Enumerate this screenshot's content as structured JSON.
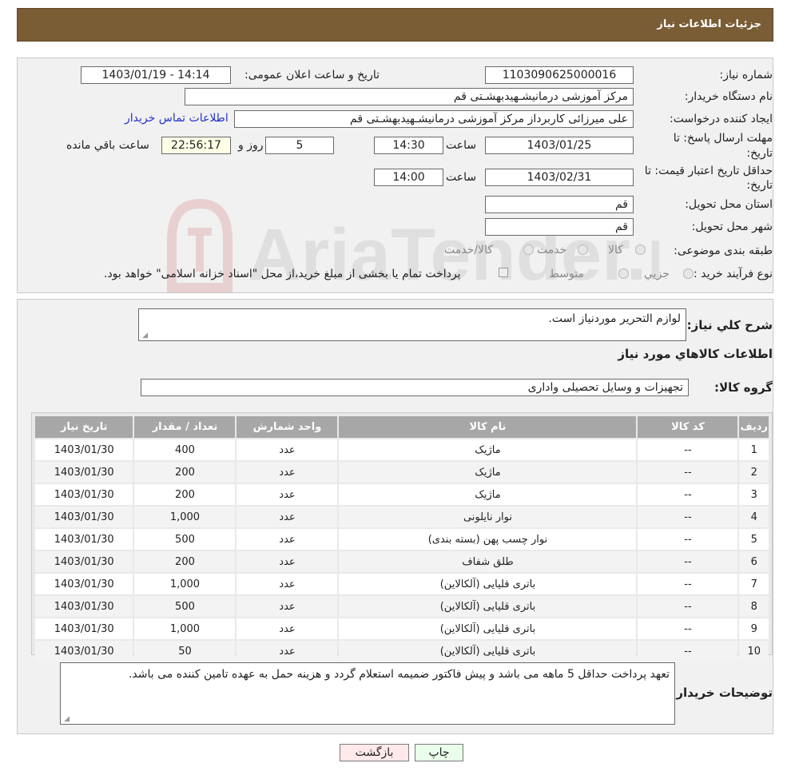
{
  "header": {
    "title": "جزئیات اطلاعات نیاز"
  },
  "form": {
    "need_number_label": "شماره نیاز:",
    "need_number": "1103090625000016",
    "announce_label": "تاریخ و ساعت اعلان عمومی:",
    "announce_value": "1403/01/19 - 14:14",
    "buyer_org_label": "نام دستگاه خریدار:",
    "buyer_org": "مرکز آموزشی درمانیشـهیدبهشـتی قم",
    "creator_label": "ایجاد کننده درخواست:",
    "creator": "علی میرزائی کاربرداز مرکز آموزشی درمانیشـهیدبهشـتی قم",
    "contact_link": "اطلاعات تماس خریدار",
    "deadline_label_1": "مهلت ارسال پاسخ: تا",
    "deadline_label_2": "تاریخ:",
    "deadline_date": "1403/01/25",
    "time_label": "ساعت",
    "deadline_time": "14:30",
    "days_value": "5",
    "days_label": "روز و",
    "remaining_time": "22:56:17",
    "remaining_label": "ساعت باقي مانده",
    "validity_label_1": "حداقل تاریخ اعتبار قیمت: تا",
    "validity_label_2": "تاریخ:",
    "validity_date": "1403/02/31",
    "validity_time": "14:00",
    "province_label": "استان محل تحویل:",
    "province": "قم",
    "city_label": "شهر محل تحویل:",
    "city": "قم",
    "category_label": "طبقه بندی موضوعی:",
    "category_options": [
      "کالا",
      "خدمت",
      "کالا/خدمت"
    ],
    "process_label": "نوع فرآیند خرید :",
    "process_options": [
      "جزیي",
      "متوسط"
    ],
    "payment_note": "پرداخت تمام یا بخشی از مبلغ خرید،از محل \"اسناد خزانه اسلامی\" خواهد بود."
  },
  "summary": {
    "label": "شرح كلي نياز:",
    "text": "لوازم التحریر موردنیاز است."
  },
  "goods": {
    "section_title": "اطلاعات كالاهاي مورد نياز",
    "group_label": "گروه كالا:",
    "group_value": "تجهیزات و وسایل تحصیلی واداری"
  },
  "table": {
    "headers": [
      "ردیف",
      "کد کالا",
      "نام کالا",
      "واحد شمارش",
      "تعداد / مقدار",
      "تاریخ نیاز"
    ],
    "rows": [
      [
        "1",
        "--",
        "ماژیک",
        "عدد",
        "400",
        "1403/01/30"
      ],
      [
        "2",
        "--",
        "ماژیک",
        "عدد",
        "200",
        "1403/01/30"
      ],
      [
        "3",
        "--",
        "ماژیک",
        "عدد",
        "200",
        "1403/01/30"
      ],
      [
        "4",
        "--",
        "نوار نایلونی",
        "عدد",
        "1,000",
        "1403/01/30"
      ],
      [
        "5",
        "--",
        "نوار چسب پهن (بسته بندی)",
        "عدد",
        "500",
        "1403/01/30"
      ],
      [
        "6",
        "--",
        "طلق شفاف",
        "عدد",
        "200",
        "1403/01/30"
      ],
      [
        "7",
        "--",
        "باتری قلیایی (آلکالاین)",
        "عدد",
        "1,000",
        "1403/01/30"
      ],
      [
        "8",
        "--",
        "باتری قلیایی (آلکالاین)",
        "عدد",
        "500",
        "1403/01/30"
      ],
      [
        "9",
        "--",
        "باتری قلیایی (آلکالاین)",
        "عدد",
        "1,000",
        "1403/01/30"
      ],
      [
        "10",
        "--",
        "باتری قلیایی (آلکالاین)",
        "عدد",
        "50",
        "1403/01/30"
      ]
    ]
  },
  "notes": {
    "label": "توضیحات خریدار:",
    "text": "تعهد پرداخت حداقل 5 ماهه می باشد و پیش فاکتور ضمیمه استعلام گردد و هزینه حمل به عهده تامین کننده می باشد."
  },
  "buttons": {
    "print": "چاپ",
    "back": "بازگشت"
  },
  "watermark": {
    "text": "AriaTender.neT"
  },
  "colors": {
    "header_bg": "#7a5c35",
    "table_header_bg": "#a7a7a7",
    "link": "#2233cc"
  }
}
